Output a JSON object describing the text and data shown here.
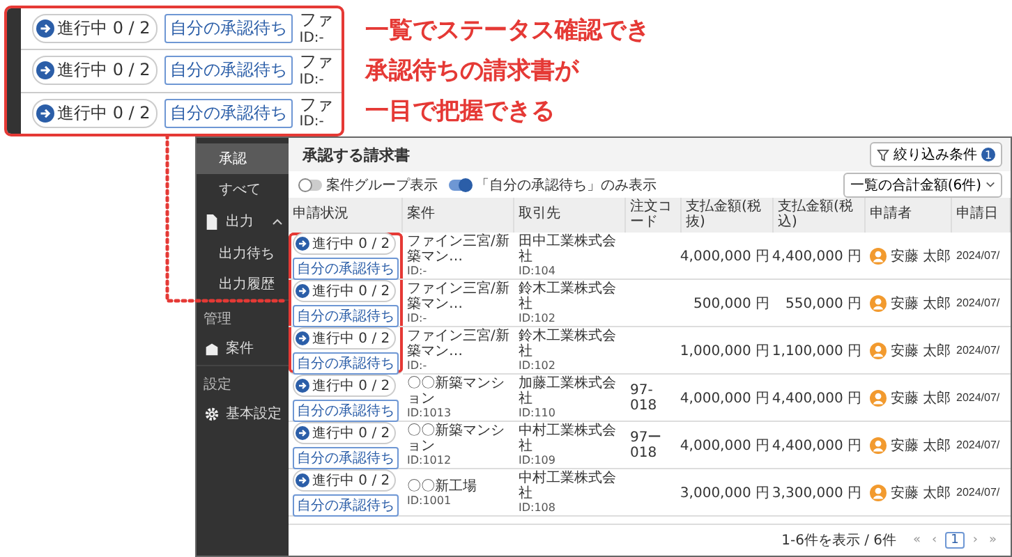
{
  "headline": [
    "一覧でステータス確認でき",
    "承認待ちの請求書が",
    "一目で把握できる"
  ],
  "callout": {
    "rows": [
      {
        "status": "進行中 0 / 2",
        "tag": "自分の承認待ち",
        "project": "ファ",
        "id": "ID:-"
      },
      {
        "status": "進行中 0 / 2",
        "tag": "自分の承認待ち",
        "project": "ファ",
        "id": "ID:-"
      },
      {
        "status": "進行中 0 / 2",
        "tag": "自分の承認待ち",
        "project": "ファ",
        "id": "ID:-"
      }
    ]
  },
  "sidebar": {
    "items": [
      {
        "kind": "sub",
        "label": "承認",
        "selected": true
      },
      {
        "kind": "sub",
        "label": "すべて",
        "selected": false
      },
      {
        "kind": "group",
        "label": "出力",
        "expanded": true
      },
      {
        "kind": "sub",
        "label": "出力待ち",
        "selected": false
      },
      {
        "kind": "sub",
        "label": "出力履歴",
        "selected": false
      },
      {
        "kind": "section",
        "label": "管理"
      },
      {
        "kind": "link",
        "label": "案件"
      },
      {
        "kind": "section",
        "label": "設定"
      },
      {
        "kind": "setting",
        "label": "基本設定"
      }
    ]
  },
  "page": {
    "title": "承認する請求書",
    "filter": {
      "label": "絞り込み条件",
      "count": "1"
    },
    "toggles": [
      {
        "label": "案件グループ表示",
        "on": false
      },
      {
        "label": "「自分の承認待ち」のみ表示",
        "on": true
      }
    ],
    "total_dropdown": "一覧の合計金額(6件)"
  },
  "table": {
    "columns": [
      "申請状況",
      "案件",
      "取引先",
      "注文コード",
      "支払金額(税抜)",
      "支払金額(税込)",
      "申請者",
      "申請日"
    ],
    "rows": [
      {
        "status": "進行中 0 / 2",
        "tag": "自分の承認待ち",
        "project": "ファイン三宮/新築マン…",
        "project_id": "ID:-",
        "client": "田中工業株式会社",
        "client_id": "ID:104",
        "code": "",
        "amount_ex": "4,000,000 円",
        "amount_in": "4,400,000 円",
        "applicant": "安藤 太郎",
        "date": "2024/07/",
        "highlighted": true
      },
      {
        "status": "進行中 0 / 2",
        "tag": "自分の承認待ち",
        "project": "ファイン三宮/新築マン…",
        "project_id": "ID:-",
        "client": "鈴木工業株式会社",
        "client_id": "ID:102",
        "code": "",
        "amount_ex": "500,000 円",
        "amount_in": "550,000 円",
        "applicant": "安藤 太郎",
        "date": "2024/07/",
        "highlighted": true
      },
      {
        "status": "進行中 0 / 2",
        "tag": "自分の承認待ち",
        "project": "ファイン三宮/新築マン…",
        "project_id": "ID:-",
        "client": "鈴木工業株式会社",
        "client_id": "ID:102",
        "code": "",
        "amount_ex": "1,000,000 円",
        "amount_in": "1,100,000 円",
        "applicant": "安藤 太郎",
        "date": "2024/07/",
        "highlighted": true
      },
      {
        "status": "進行中 0 / 2",
        "tag": "自分の承認待ち",
        "project": "〇〇新築マンション",
        "project_id": "ID:1013",
        "client": "加藤工業株式会社",
        "client_id": "ID:110",
        "code": "97-018",
        "amount_ex": "4,000,000 円",
        "amount_in": "4,400,000 円",
        "applicant": "安藤 太郎",
        "date": "2024/07/",
        "highlighted": false
      },
      {
        "status": "進行中 0 / 2",
        "tag": "自分の承認待ち",
        "project": "〇〇新築マンション",
        "project_id": "ID:1012",
        "client": "中村工業株式会社",
        "client_id": "ID:109",
        "code": "97ー018",
        "amount_ex": "4,000,000 円",
        "amount_in": "4,400,000 円",
        "applicant": "安藤 太郎",
        "date": "2024/07/",
        "highlighted": false
      },
      {
        "status": "進行中 0 / 2",
        "tag": "自分の承認待ち",
        "project": "〇〇新工場",
        "project_id": "ID:1001",
        "client": "中村工業株式会社",
        "client_id": "ID:108",
        "code": "",
        "amount_ex": "3,000,000 円",
        "amount_in": "3,300,000 円",
        "applicant": "安藤 太郎",
        "date": "2024/07/",
        "highlighted": false
      }
    ]
  },
  "pager": {
    "summary": "1-6件を表示 / 6件",
    "first": "«",
    "prev": "‹",
    "pages": [
      {
        "label": "1",
        "selected": true
      }
    ],
    "next": "›",
    "last": "»"
  }
}
